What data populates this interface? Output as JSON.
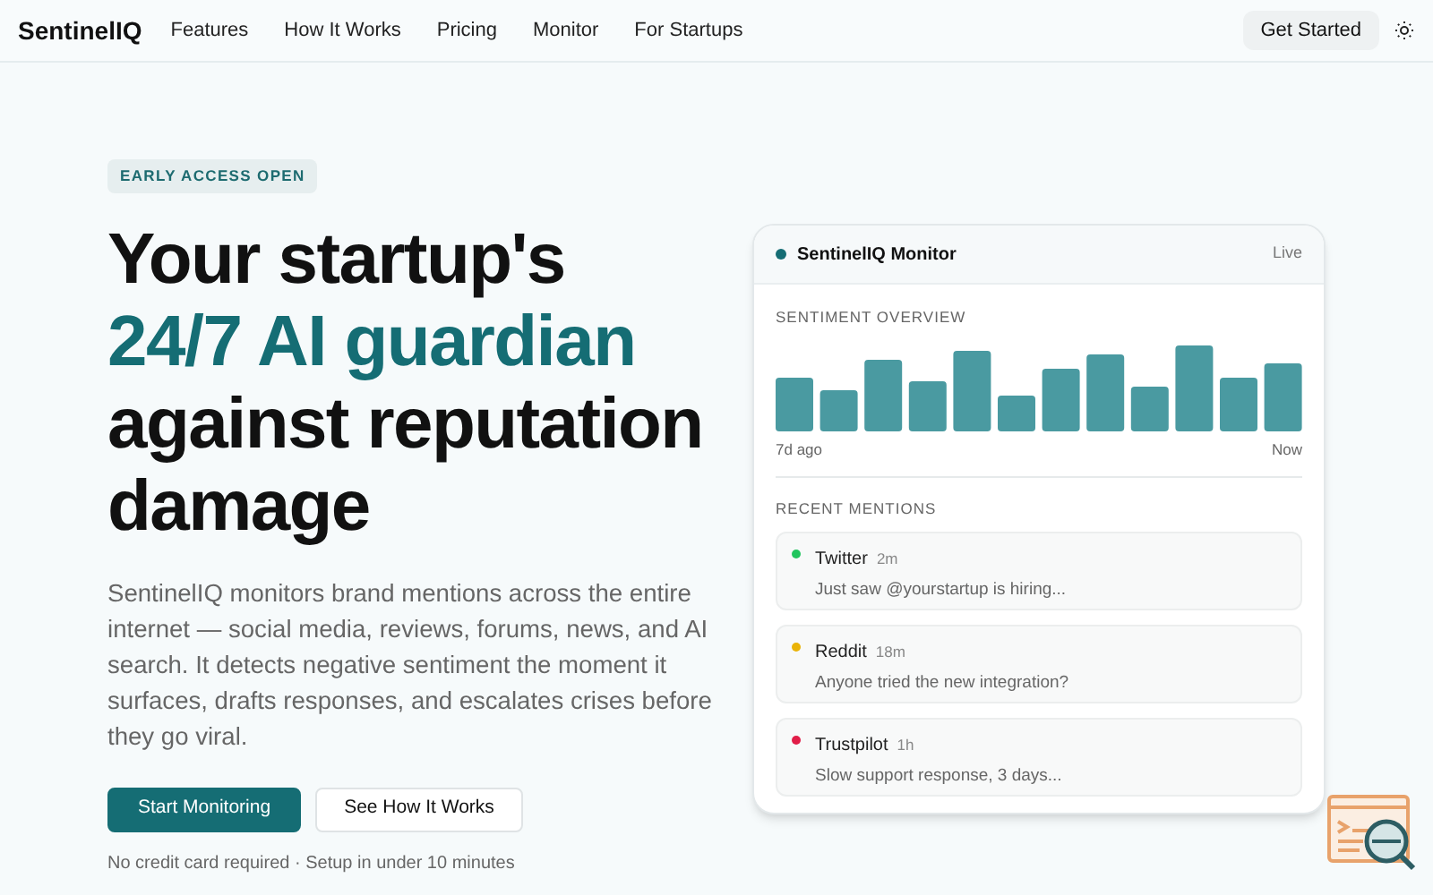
{
  "nav": {
    "brand": "SentinelIQ",
    "links": [
      "Features",
      "How It Works",
      "Pricing",
      "Monitor",
      "For Startups"
    ],
    "cta": "Get Started"
  },
  "hero": {
    "badge": "EARLY ACCESS OPEN",
    "headline": [
      {
        "text": "Your startup's",
        "accent": false
      },
      {
        "text": "24/7 AI guardian",
        "accent": true
      },
      {
        "text": "against reputation",
        "accent": false
      },
      {
        "text": "damage",
        "accent": false
      }
    ],
    "description": "SentinelIQ monitors brand mentions across the entire internet — social media, reviews, forums, news, and AI search. It detects negative sentiment the moment it surfaces, drafts responses, and escalates crises before they go viral.",
    "buttons": [
      {
        "label": "Start Monitoring",
        "kind": "primary"
      },
      {
        "label": "See How It Works",
        "kind": "secondary"
      }
    ],
    "note": "No credit card required · Setup in under 10 minutes"
  },
  "monitor": {
    "title": "SentinelIQ Monitor",
    "status": "Live",
    "sentiment_heading": "SENTIMENT OVERVIEW",
    "axis_start": "7d ago",
    "axis_end": "Now",
    "mentions_heading": "RECENT MENTIONS",
    "mentions": [
      {
        "source": "Twitter",
        "time": "2m",
        "text": "Just saw @yourstartup is hiring...",
        "color": "#22c55e"
      },
      {
        "source": "Reddit",
        "time": "18m",
        "text": "Anyone tried the new integration?",
        "color": "#eab308"
      },
      {
        "source": "Trustpilot",
        "time": "1h",
        "text": "Slow support response, 3 days...",
        "color": "#e11d48"
      }
    ]
  }
}
